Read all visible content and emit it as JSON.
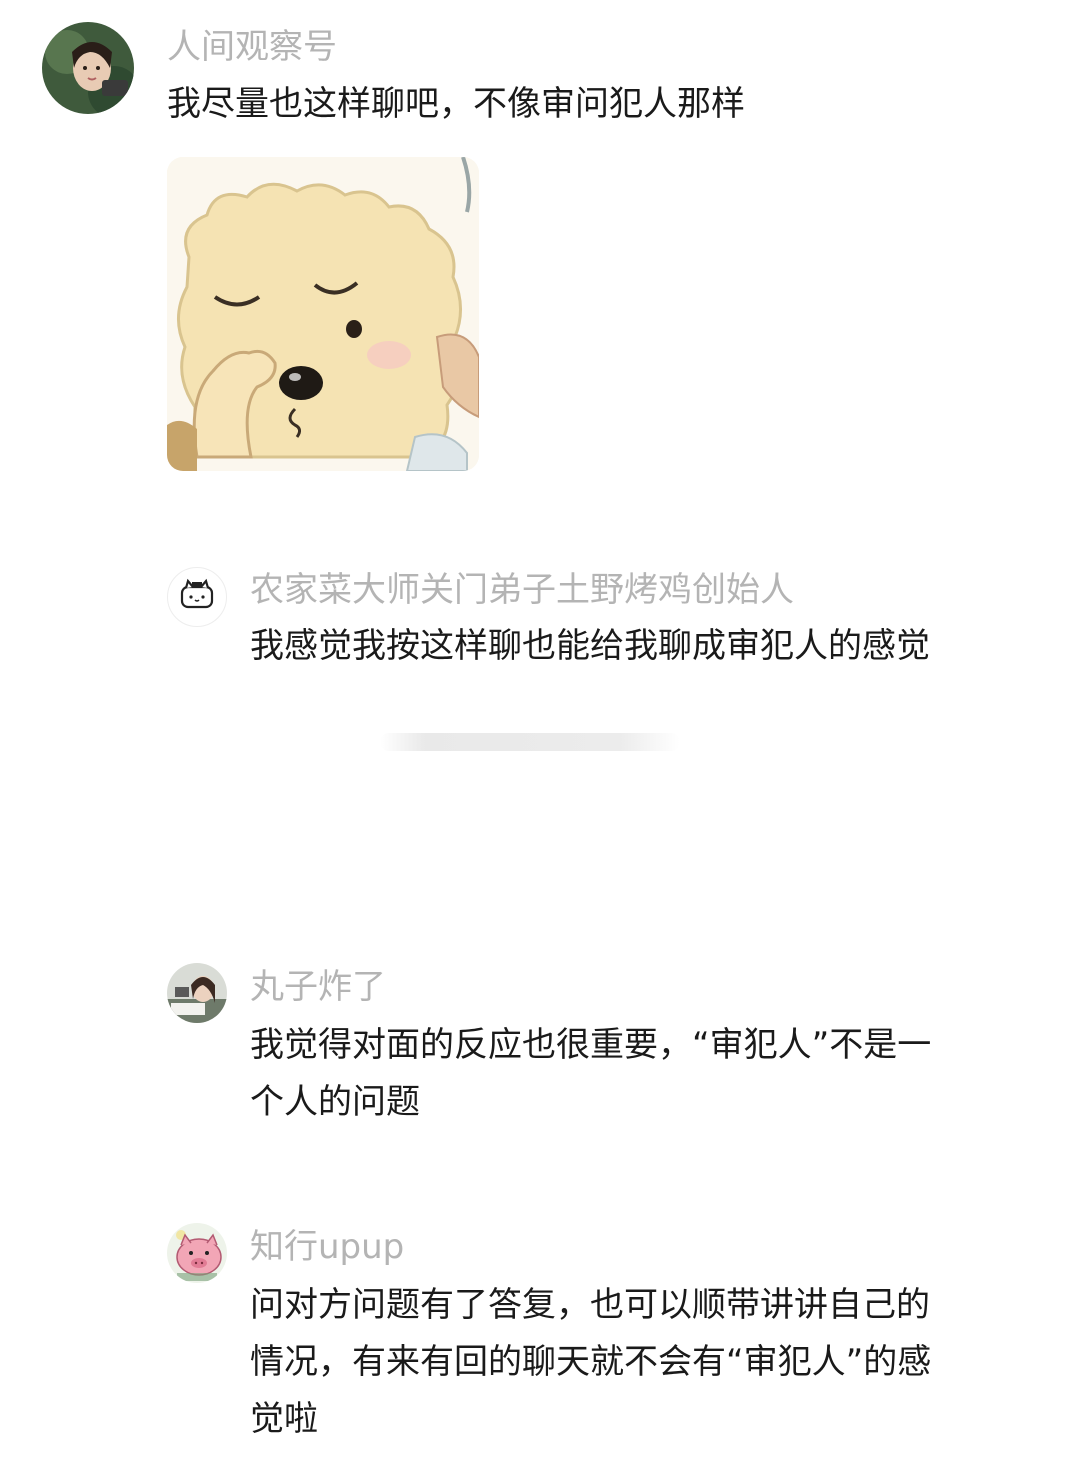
{
  "comments": [
    {
      "username": "人间观察号",
      "text": "我尽量也这样聊吧，不像审问犯人那样",
      "avatar": "girl-photo-avatar",
      "sticker": "sleepy-sheep-sticker"
    },
    {
      "username": "农家菜大师关门弟子土野烤鸡创始人",
      "text": "我感觉我按这样聊也能给我聊成审犯人的感觉",
      "avatar": "cartoon-cat-avatar"
    },
    {
      "username": "丸子炸了",
      "text": "我觉得对面的反应也很重要，“审犯人”不是一个人的问题",
      "avatar": "girl-studying-avatar"
    },
    {
      "username": "知行upup",
      "text": "问对方问题有了答复，也可以顺带讲讲自己的情况，有来有回的聊天就不会有“审犯人”的感觉啦",
      "avatar": "pink-pig-avatar"
    }
  ]
}
